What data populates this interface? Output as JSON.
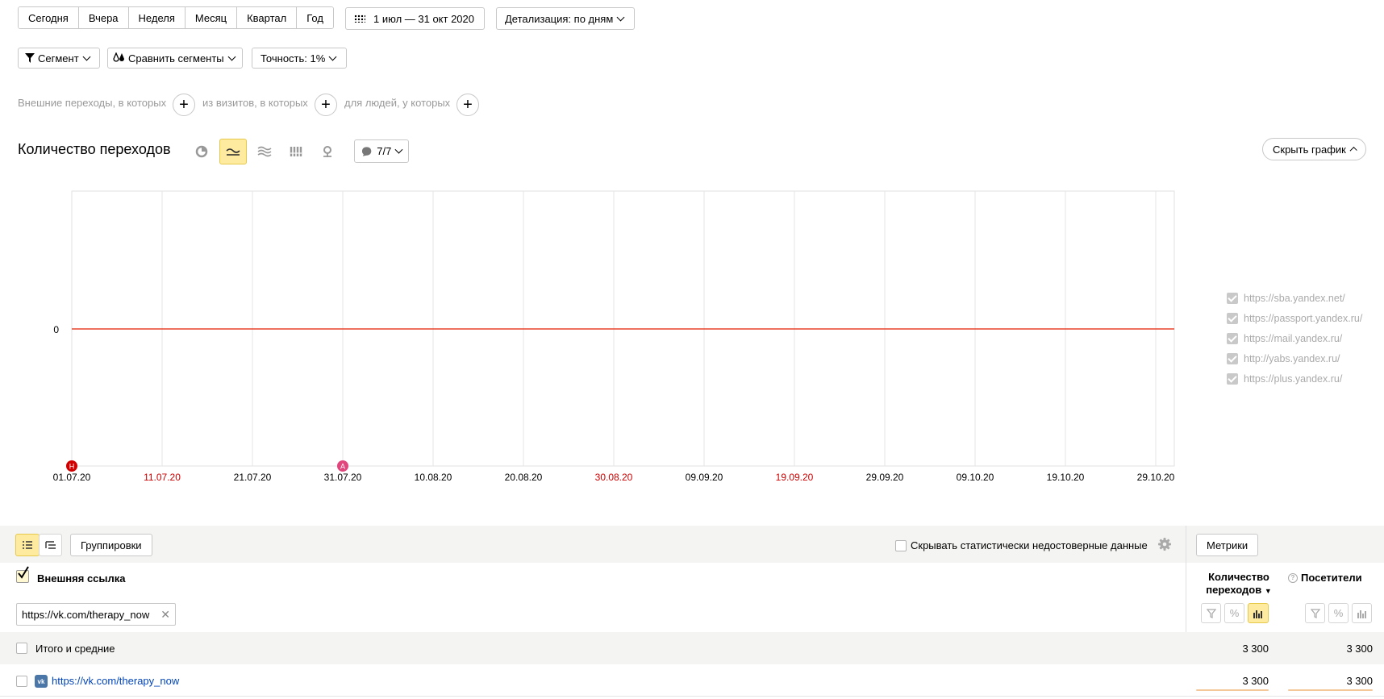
{
  "period_tabs": [
    "Сегодня",
    "Вчера",
    "Неделя",
    "Месяц",
    "Квартал",
    "Год"
  ],
  "date_range": "1 июл — 31 окт 2020",
  "detail": "Детализация: по дням",
  "segment": "Сегмент",
  "compare": "Сравнить сегменты",
  "accuracy": "Точность: 1%",
  "filter_texts": [
    "Внешние переходы, в которых",
    "из визитов, в которых",
    "для людей, у которых"
  ],
  "chart_title": "Количество переходов",
  "comments_count": "7/7",
  "hide_chart": "Скрыть график",
  "chart_data": {
    "type": "line",
    "x": [
      "01.07.20",
      "11.07.20",
      "21.07.20",
      "31.07.20",
      "10.08.20",
      "20.08.20",
      "30.08.20",
      "09.09.20",
      "19.09.20",
      "29.09.20",
      "09.10.20",
      "19.10.20",
      "29.10.20"
    ],
    "red_ticks": [
      "11.07.20",
      "30.08.20",
      "19.09.20"
    ],
    "y_ticks": [
      "0"
    ],
    "series": [
      {
        "name": "https://sba.yandex.net/",
        "values": [
          0,
          0,
          0,
          0,
          0,
          0,
          0,
          0,
          0,
          0,
          0,
          0,
          0
        ],
        "color": "#e8422a"
      }
    ],
    "legend": [
      "https://sba.yandex.net/",
      "https://passport.yandex.ru/",
      "https://mail.yandex.ru/",
      "http://yabs.yandex.ru/",
      "https://plus.yandex.ru/"
    ],
    "markers": [
      {
        "label": "Н",
        "x": "01.07.20",
        "color": "#d10000"
      },
      {
        "label": "А",
        "x": "31.07.20",
        "color": "#e0457b"
      }
    ]
  },
  "groupings": "Группировки",
  "hide_unreliable": "Скрывать статистически недостоверные данные",
  "metrics": "Метрики",
  "dimension_header": "Внешняя ссылка",
  "filter_value": "https://vk.com/therapy_now",
  "col1_header": "Количество переходов",
  "col2_header": "Посетители",
  "total_label": "Итого и средние",
  "total_values": [
    "3 300",
    "3 300"
  ],
  "row_link": "https://vk.com/therapy_now",
  "row_values": [
    "3 300",
    "3 300"
  ]
}
